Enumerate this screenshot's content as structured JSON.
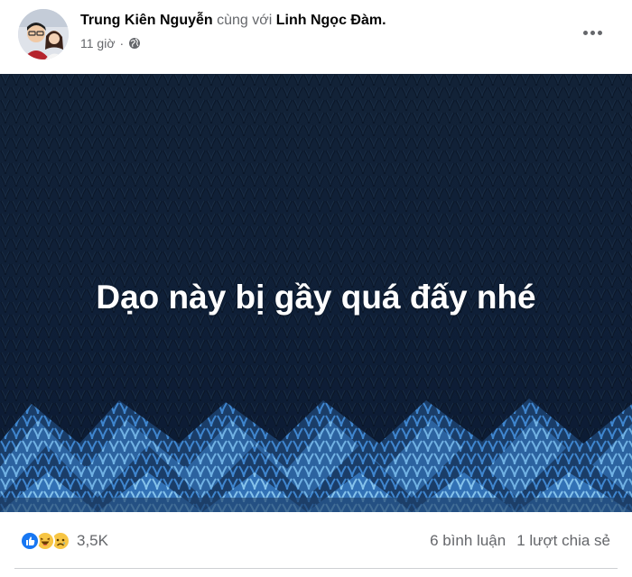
{
  "post": {
    "author": "Trung Kiên Nguyễn",
    "with_text": "cùng với",
    "tagged": "Linh Ngọc Đàm",
    "period": ".",
    "time": "11 giờ",
    "separator": "·",
    "privacy_icon": "globe-icon",
    "more_icon": "more-options-icon",
    "text": "Dạo này bị gầy quá đấy nhé",
    "background_colors": {
      "base": "#0f1f37",
      "pattern": "#3f86cf",
      "light": "#8ac8ef"
    }
  },
  "engagement": {
    "reaction_icons": [
      "like-icon",
      "haha-icon",
      "sad-icon"
    ],
    "reaction_count": "3,5K",
    "comments": "6 bình luận",
    "shares": "1 lượt chia sẻ"
  }
}
